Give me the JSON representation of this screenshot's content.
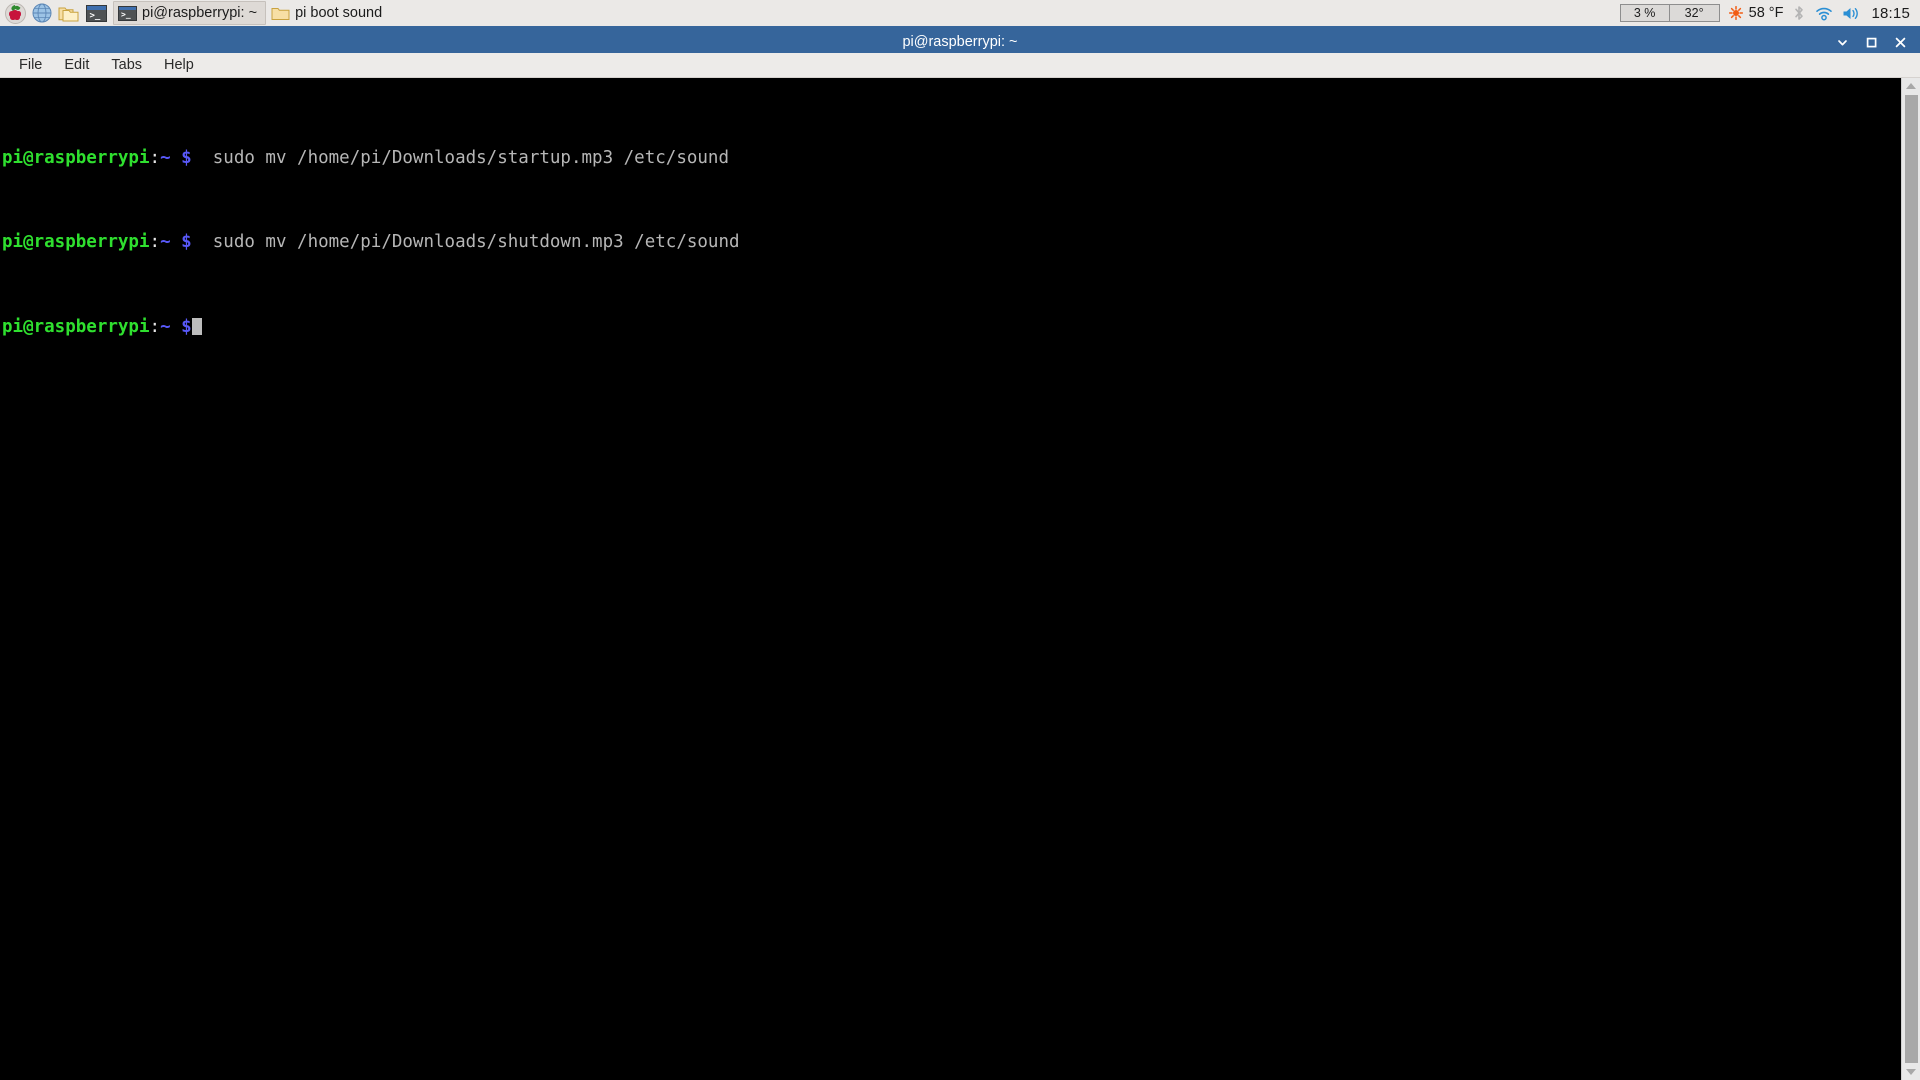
{
  "taskbar": {
    "launchers": [
      {
        "name": "raspberry-menu-icon",
        "label": "Menu"
      },
      {
        "name": "browser-icon",
        "label": "Web Browser"
      },
      {
        "name": "file-manager-icon",
        "label": "File Manager"
      },
      {
        "name": "terminal-icon",
        "label": "Terminal"
      }
    ],
    "tasks": [
      {
        "label": "pi@raspberrypi: ~",
        "icon": "terminal-icon",
        "active": true
      },
      {
        "label": "pi boot sound",
        "icon": "folder-icon",
        "active": false
      }
    ],
    "tray": {
      "cpu_usage": "3 %",
      "cpu_temp": "32°",
      "weather_temp": "58 °F",
      "weather_icon": "sun-icon",
      "bluetooth_icon": "bluetooth-icon",
      "wifi_icon": "wifi-icon",
      "volume_icon": "speaker-icon",
      "clock": "18:15"
    }
  },
  "window": {
    "title": "pi@raspberrypi: ~",
    "controls": {
      "minimize": "minimize-icon",
      "maximize": "maximize-icon",
      "close": "close-icon"
    },
    "menu": [
      {
        "label": "File"
      },
      {
        "label": "Edit"
      },
      {
        "label": "Tabs"
      },
      {
        "label": "Help"
      }
    ]
  },
  "terminal": {
    "prompt_user": "pi@raspberrypi",
    "prompt_colon": ":",
    "prompt_path": "~ $",
    "lines": [
      {
        "command": "  sudo mv /home/pi/Downloads/startup.mp3 /etc/sound"
      },
      {
        "command": "  sudo mv /home/pi/Downloads/shutdown.mp3 /etc/sound"
      },
      {
        "command": ""
      }
    ]
  },
  "colors": {
    "titlebar_blue": "#36659b",
    "taskbar_grey": "#ebe9e7",
    "terminal_bg": "#000000",
    "prompt_green": "#2fe02f",
    "prompt_blue": "#5858f8",
    "command_grey": "#b6b6b6"
  }
}
